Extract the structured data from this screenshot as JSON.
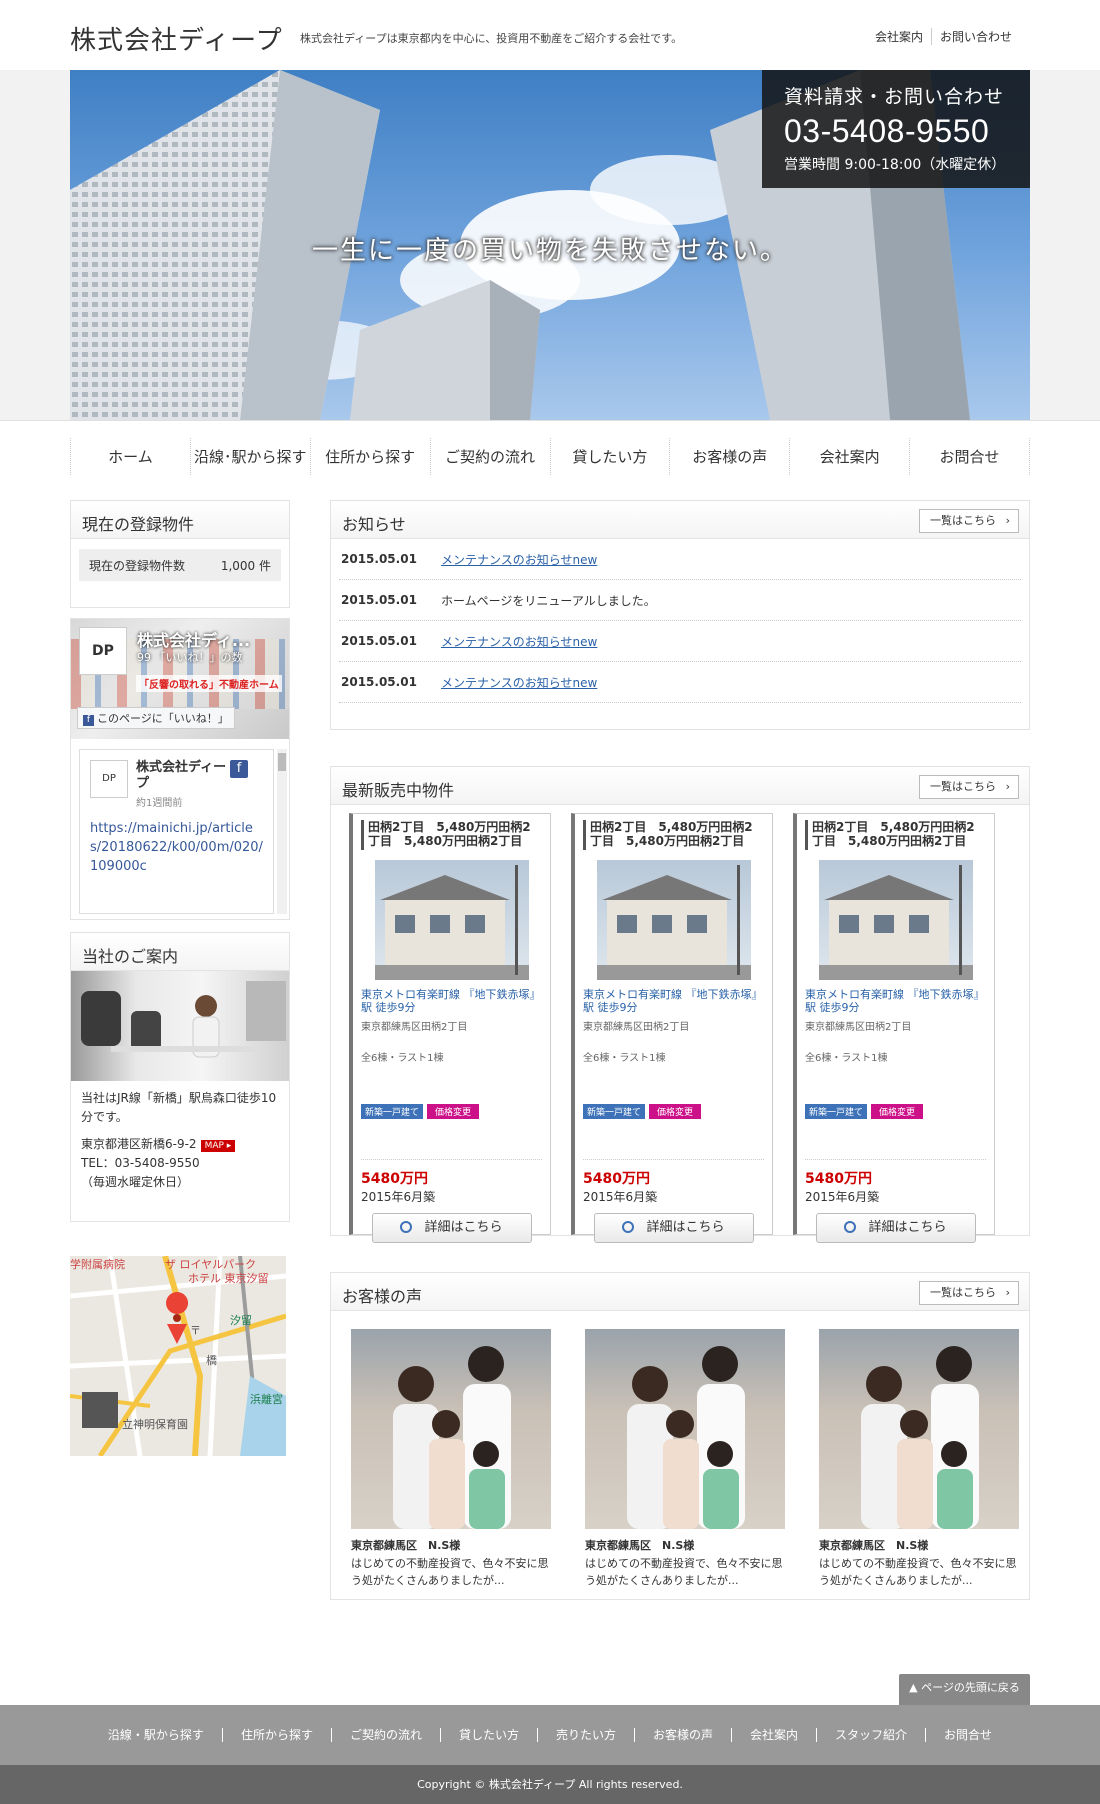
{
  "header": {
    "logo": "株式会社ディープ",
    "tagline": "株式会社ディープは東京都内を中心に、投資用不動産をご紹介する会社です。",
    "links": [
      "会社案内",
      "お問い合わせ"
    ]
  },
  "hero": {
    "catchcopy": "一生に一度の買い物を失敗させない。",
    "contact_title": "資料請求・お問い合わせ",
    "contact_tel": "03-5408-9550",
    "contact_hours": "営業時間 9:00-18:00（水曜定休）"
  },
  "gnav": [
    "ホーム",
    "沿線･駅から探す",
    "住所から探す",
    "ご契約の流れ",
    "貸したい方",
    "お客様の声",
    "会社案内",
    "お問合せ"
  ],
  "sidebar": {
    "count_title": "現在の登録物件",
    "count_label": "現在の登録物件数",
    "count_value": "1,000 件",
    "fb": {
      "logo": "DP",
      "page_name": "株式会社ディ...",
      "likes": "99 「いいね！」の数",
      "ad_text": "「反響の取れる」不動産ホーム",
      "like_button": "このページに「いいね！」",
      "post_name": "株式会社ディープ",
      "post_time": "約1週間前",
      "post_url": "https://mainichi.jp/articles/20180622/k00/00m/020/109000c"
    },
    "guide_title": "当社のご案内",
    "guide_access": "当社はJR線「新橋」駅烏森口徒歩10分です。",
    "guide_address": "東京都港区新橋6-9-2",
    "map_badge": "MAP ▸",
    "guide_tel": "TEL：03-5408-9550",
    "guide_holiday": "（毎週水曜定休日）",
    "map_labels": [
      "学附属病院",
      "ザ ロイヤルパーク",
      "ホテル 東京汐留",
      "汐留",
      "浜離宮",
      "立神明保育園",
      "橋",
      "〒"
    ]
  },
  "news": {
    "title": "お知らせ",
    "more": "一覧はこちら",
    "items": [
      {
        "date": "2015.05.01",
        "text": "メンテナンスのお知らせnew",
        "link": true
      },
      {
        "date": "2015.05.01",
        "text": "ホームページをリニューアルしました。",
        "link": false
      },
      {
        "date": "2015.05.01",
        "text": "メンテナンスのお知らせnew",
        "link": true
      },
      {
        "date": "2015.05.01",
        "text": "メンテナンスのお知らせnew",
        "link": true
      }
    ]
  },
  "properties": {
    "title": "最新販売中物件",
    "more": "一覧はこちら",
    "items": [
      {
        "title": "田柄2丁目　5,480万円田柄2丁目　5,480万円田柄2丁目",
        "line": "東京メトロ有楽町線 『地下鉄赤塚』駅 徒歩9分",
        "address": "東京都練馬区田柄2丁目",
        "units": "全6棟・ラスト1棟",
        "tag1": "新築一戸建て",
        "tag2": "価格変更",
        "price": "5480万円",
        "built": "2015年6月築",
        "button": "詳細はこちら"
      },
      {
        "title": "田柄2丁目　5,480万円田柄2丁目　5,480万円田柄2丁目",
        "line": "東京メトロ有楽町線 『地下鉄赤塚』駅 徒歩9分",
        "address": "東京都練馬区田柄2丁目",
        "units": "全6棟・ラスト1棟",
        "tag1": "新築一戸建て",
        "tag2": "価格変更",
        "price": "5480万円",
        "built": "2015年6月築",
        "button": "詳細はこちら"
      },
      {
        "title": "田柄2丁目　5,480万円田柄2丁目　5,480万円田柄2丁目",
        "line": "東京メトロ有楽町線 『地下鉄赤塚』駅 徒歩9分",
        "address": "東京都練馬区田柄2丁目",
        "units": "全6棟・ラスト1棟",
        "tag1": "新築一戸建て",
        "tag2": "価格変更",
        "price": "5480万円",
        "built": "2015年6月築",
        "button": "詳細はこちら"
      }
    ]
  },
  "voices": {
    "title": "お客様の声",
    "more": "一覧はこちら",
    "items": [
      {
        "name": "東京都練馬区　N.S様",
        "text": "はじめての不動産投資で、色々不安に思う処がたくさんありましたが..."
      },
      {
        "name": "東京都練馬区　N.S様",
        "text": "はじめての不動産投資で、色々不安に思う処がたくさんありましたが..."
      },
      {
        "name": "東京都練馬区　N.S様",
        "text": "はじめての不動産投資で、色々不安に思う処がたくさんありましたが..."
      }
    ]
  },
  "pagetop": "ページの先頭に戻る",
  "footer": {
    "nav": [
      "沿線・駅から探す",
      "住所から探す",
      "ご契約の流れ",
      "貸したい方",
      "売りたい方",
      "お客様の声",
      "会社案内",
      "スタッフ紹介",
      "お問合せ"
    ],
    "copyright": "Copyright © 株式会社ディープ All rights reserved."
  },
  "colors": {
    "accent": "#2a62a8",
    "price": "#cc0000",
    "tag_blue": "#3d72b8",
    "tag_pink": "#cc1188",
    "footer": "#999999"
  }
}
